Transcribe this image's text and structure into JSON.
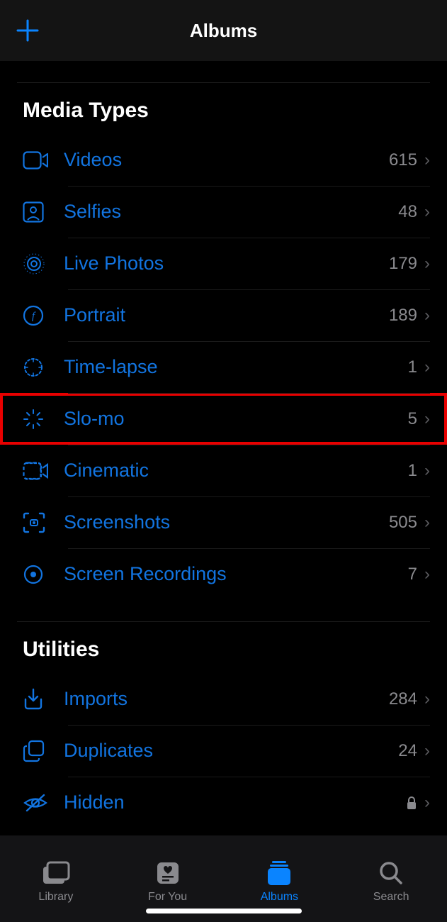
{
  "navbar": {
    "title": "Albums"
  },
  "sections": {
    "media_types": {
      "title": "Media Types",
      "items": [
        {
          "label": "Videos",
          "count": "615"
        },
        {
          "label": "Selfies",
          "count": "48"
        },
        {
          "label": "Live Photos",
          "count": "179"
        },
        {
          "label": "Portrait",
          "count": "189"
        },
        {
          "label": "Time-lapse",
          "count": "1"
        },
        {
          "label": "Slo-mo",
          "count": "5"
        },
        {
          "label": "Cinematic",
          "count": "1"
        },
        {
          "label": "Screenshots",
          "count": "505"
        },
        {
          "label": "Screen Recordings",
          "count": "7"
        }
      ]
    },
    "utilities": {
      "title": "Utilities",
      "items": [
        {
          "label": "Imports",
          "count": "284"
        },
        {
          "label": "Duplicates",
          "count": "24"
        },
        {
          "label": "Hidden"
        }
      ]
    }
  },
  "tabs": {
    "library": "Library",
    "for_you": "For You",
    "albums": "Albums",
    "search": "Search"
  }
}
